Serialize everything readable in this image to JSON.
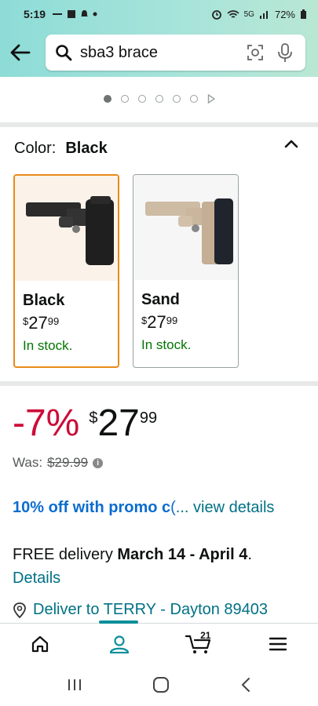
{
  "status_bar": {
    "time": "5:19",
    "network": "5G",
    "battery": "72%"
  },
  "search": {
    "query": "sba3 brace"
  },
  "color_selector": {
    "label": "Color:",
    "selected": "Black",
    "options": [
      {
        "name": "Black",
        "currency": "$",
        "whole": "27",
        "fraction": "99",
        "stock": "In stock."
      },
      {
        "name": "Sand",
        "currency": "$",
        "whole": "27",
        "fraction": "99",
        "stock": "In stock."
      }
    ]
  },
  "price": {
    "discount": "-7%",
    "currency": "$",
    "whole": "27",
    "fraction": "99",
    "was_label": "Was:",
    "was_price": "$29.99"
  },
  "promo": {
    "bold_text": "10% off with promo c",
    "trunc": "(",
    "link": "... view details"
  },
  "delivery": {
    "prefix": "FREE delivery ",
    "dates": "March 14 - April 4",
    "suffix": ".",
    "details_link": "Details"
  },
  "deliver_to": {
    "text": "Deliver to TERRY - Dayton 89403"
  },
  "bottom_nav": {
    "cart_count": "21"
  },
  "colors": {
    "accent_teal": "#8edcd7",
    "selected_border": "#e88a1a",
    "discount_red": "#cc0c39",
    "stock_green": "#007600",
    "link_blue": "#007185",
    "promo_blue": "#0b6ccf"
  },
  "icons": [
    "back-arrow-icon",
    "search-icon",
    "camera-scan-icon",
    "mic-icon",
    "chevron-up-icon",
    "info-icon",
    "location-pin-icon",
    "home-icon",
    "account-icon",
    "cart-icon",
    "menu-icon",
    "recents-icon",
    "home-button-icon",
    "back-button-icon"
  ]
}
